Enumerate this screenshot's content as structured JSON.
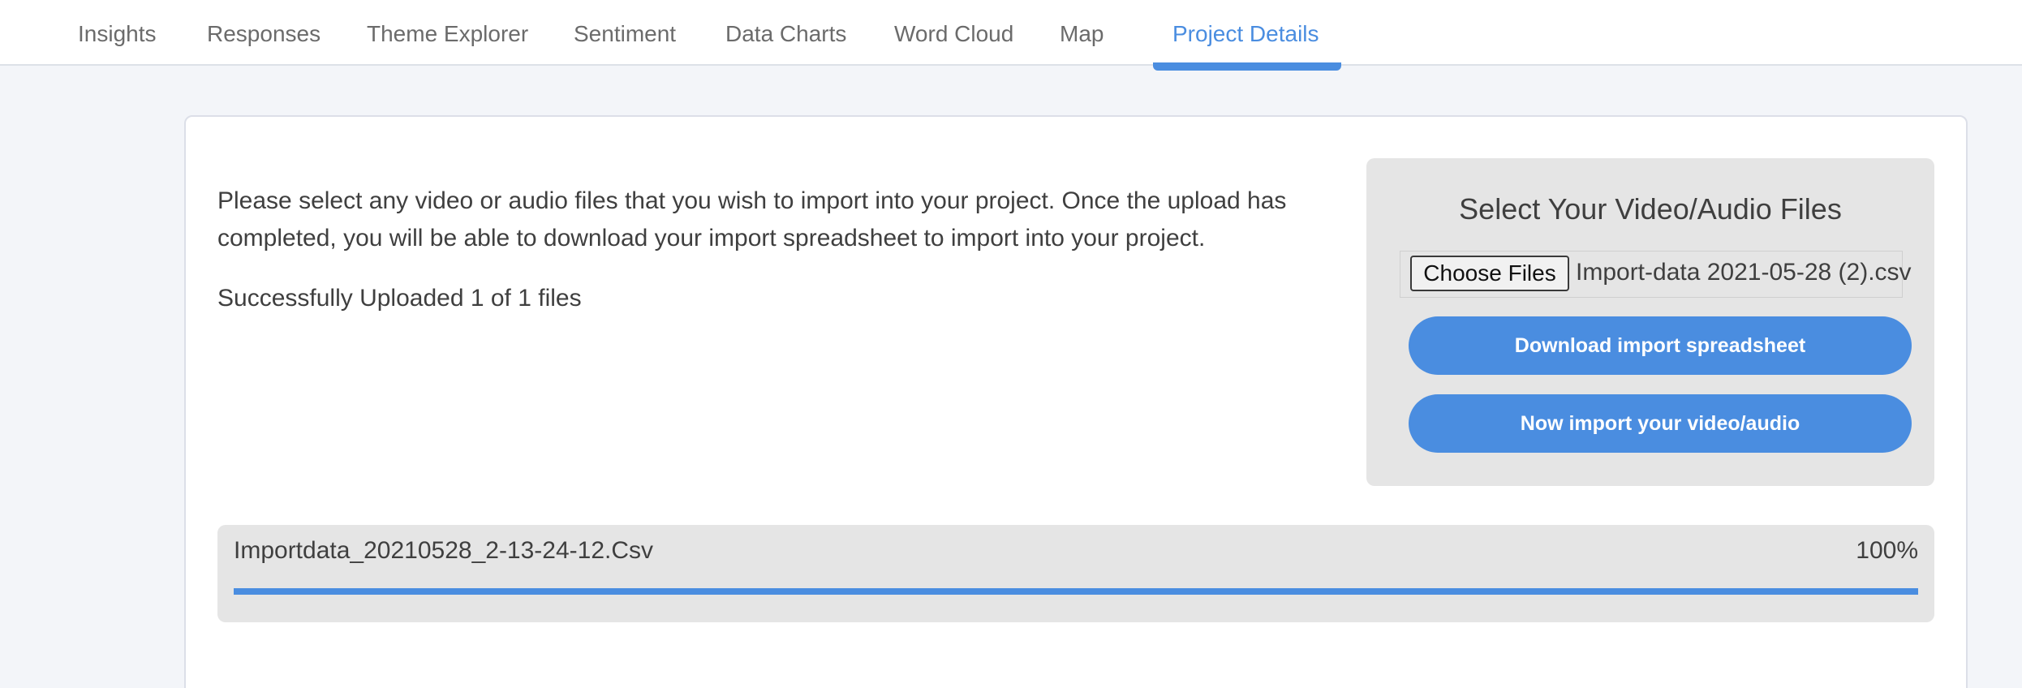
{
  "nav": {
    "tabs": [
      {
        "label": "Insights"
      },
      {
        "label": "Responses"
      },
      {
        "label": "Theme Explorer"
      },
      {
        "label": "Sentiment"
      },
      {
        "label": "Data Charts"
      },
      {
        "label": "Word Cloud"
      },
      {
        "label": "Map"
      },
      {
        "label": "Project Details",
        "active": true
      }
    ]
  },
  "main": {
    "intro": "Please select any video or audio files that you wish to import into your project. Once the upload has completed, you will be able to download your import spreadsheet to import into your project.",
    "status": "Successfully Uploaded 1 of 1 files"
  },
  "panel": {
    "title": "Select Your Video/Audio Files",
    "choose_label": "Choose Files",
    "file_name": "Import-data 2021-05-28 (2).csv",
    "download_label": "Download import spreadsheet",
    "import_label": "Now import your video/audio"
  },
  "upload": {
    "file_name": "Importdata_20210528_2-13-24-12.Csv",
    "percent_label": "100%",
    "progress": 1.0
  },
  "colors": {
    "accent": "#4a8de0",
    "page_bg": "#f3f5f9",
    "panel_bg": "#e5e5e5"
  }
}
